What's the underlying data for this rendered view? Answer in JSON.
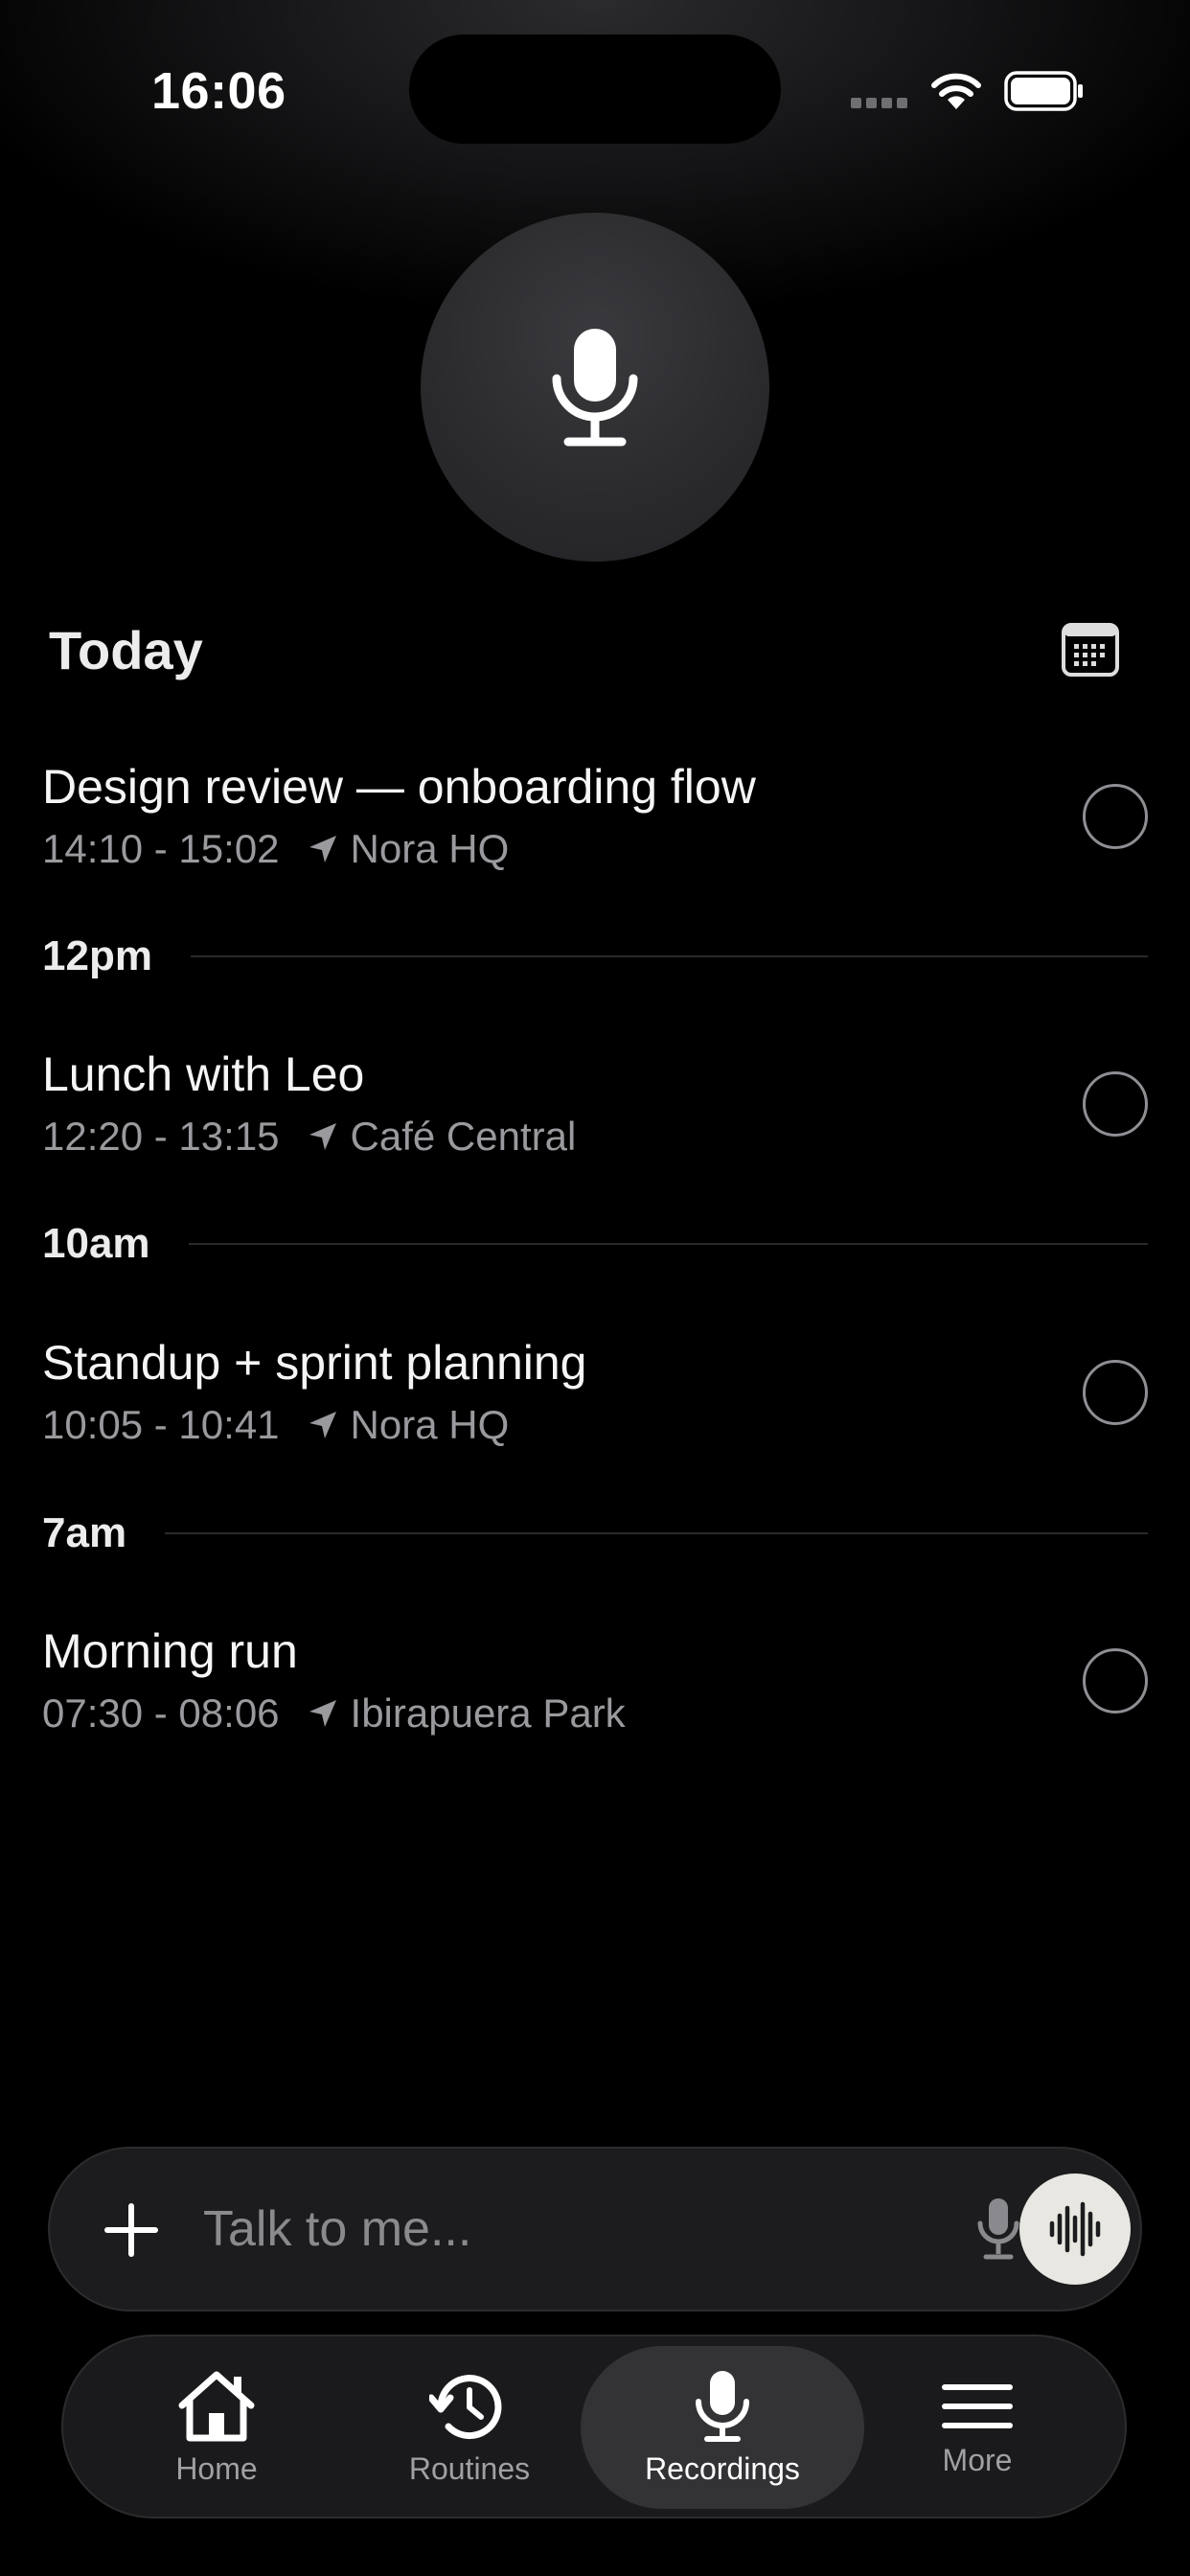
{
  "status_bar": {
    "time": "16:06"
  },
  "main_button": {
    "icon": "microphone-icon"
  },
  "section": {
    "title": "Today",
    "calendar_icon": "calendar-icon"
  },
  "events": [
    {
      "title": "Design review — onboarding flow",
      "time": "14:10 - 15:02",
      "location": "Nora HQ"
    },
    {
      "title": "Lunch with Leo",
      "time": "12:20 - 13:15",
      "location": "Café Central"
    },
    {
      "title": "Standup + sprint planning",
      "time": "10:05 - 10:41",
      "location": "Nora HQ"
    },
    {
      "title": "Morning run",
      "time": "07:30 - 08:06",
      "location": "Ibirapuera Park"
    }
  ],
  "hour_separators": [
    "12pm",
    "10am",
    "7am"
  ],
  "input": {
    "placeholder": "Talk to me..."
  },
  "tabs": [
    {
      "label": "Home",
      "icon": "home-icon"
    },
    {
      "label": "Routines",
      "icon": "history-icon"
    },
    {
      "label": "Recordings",
      "icon": "microphone-icon",
      "active": true
    },
    {
      "label": "More",
      "icon": "menu-icon"
    }
  ],
  "colors": {
    "background": "#000000",
    "accent_button": "#e9e7e2",
    "muted_text": "#9a9a9e"
  }
}
